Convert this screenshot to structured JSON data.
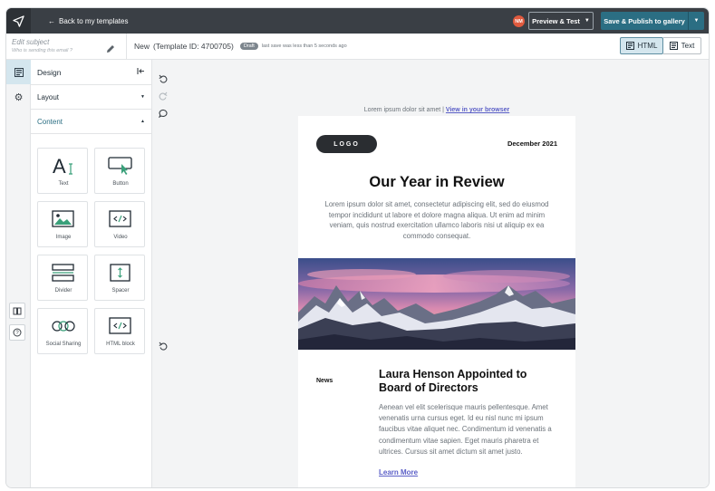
{
  "topbar": {
    "back_label": "Back to my templates",
    "avatar_initials": "NM",
    "preview_label": "Preview & Test",
    "publish_label": "Save & Publish to gallery",
    "publish_color": "#2b6e83"
  },
  "subheader": {
    "subject_placeholder": "Edit subject",
    "sender_placeholder": "Who is sending this email ?",
    "template_status": "New",
    "template_id": "(Template ID: 4700705)",
    "draft_badge": "Draft",
    "last_save": "last save was less than 5 seconds ago",
    "html_label": "HTML",
    "text_label": "Text"
  },
  "panel": {
    "title": "Design",
    "layout_label": "Layout",
    "content_label": "Content",
    "accent": "#2b6e83",
    "blocks": [
      {
        "label": "Text",
        "icon": "text-icon"
      },
      {
        "label": "Button",
        "icon": "button-icon"
      },
      {
        "label": "Image",
        "icon": "image-icon"
      },
      {
        "label": "Video",
        "icon": "video-icon"
      },
      {
        "label": "Divider",
        "icon": "divider-icon"
      },
      {
        "label": "Spacer",
        "icon": "spacer-icon"
      },
      {
        "label": "Social Sharing",
        "icon": "social-icon"
      },
      {
        "label": "HTML block",
        "icon": "code-icon"
      }
    ]
  },
  "email": {
    "preheader_text": "Lorem ipsum dolor sit amet |",
    "view_in_browser": "View in your browser",
    "logo_text": "LOGO",
    "date": "December 2021",
    "headline": "Our Year in Review",
    "intro": "Lorem ipsum dolor sit amet, consectetur adipiscing elit, sed do eiusmod tempor incididunt ut labore et dolore magna aliqua. Ut enim ad minim veniam, quis nostrud exercitation ullamco laboris nisi ut aliquip ex ea commodo consequat.",
    "news_label": "News",
    "article_title": "Laura Henson Appointed to Board of Directors",
    "article_body": "Aenean vel elit scelerisque mauris pellentesque. Amet venenatis urna cursus eget. Id eu nisl nunc mi ipsum faucibus vitae aliquet nec. Condimentum id venenatis a condimentum vitae sapien. Eget mauris pharetra et ultrices. Cursus sit amet dictum sit amet justo.",
    "learn_more": "Learn More",
    "link_color": "#5b5fc7"
  }
}
